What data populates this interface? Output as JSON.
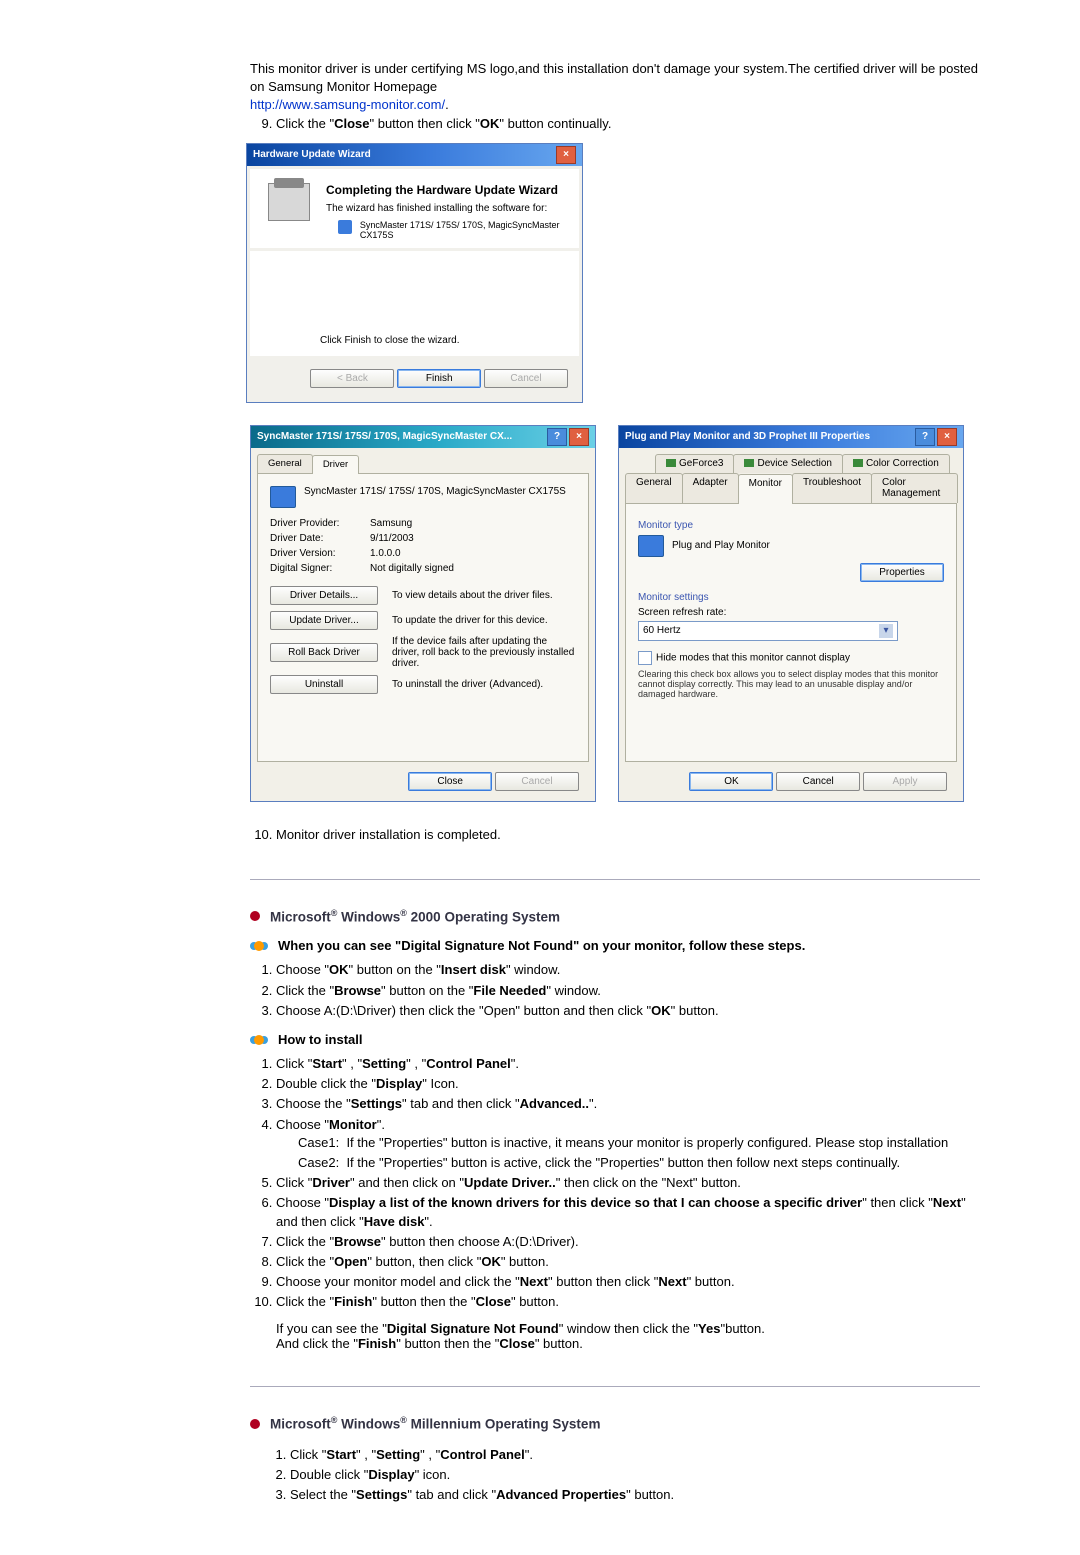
{
  "intro": {
    "line1": "This monitor driver is under certifying MS logo,and this installation don't damage your system.The certified driver will be posted on Samsung Monitor Homepage",
    "link": "http://www.samsung-monitor.com/",
    "period": ".",
    "step9_prefix": "Click the \"",
    "step9_close": "Close",
    "step9_mid": "\" button then click \"",
    "step9_ok": "OK",
    "step9_suffix": "\" button continually."
  },
  "wizard": {
    "title": "Hardware Update Wizard",
    "heading": "Completing the Hardware Update Wizard",
    "line": "The wizard has finished installing the software for:",
    "device": "SyncMaster 171S/ 175S/ 170S, MagicSyncMaster CX175S",
    "close_line": "Click Finish to close the wizard.",
    "btn_back": "< Back",
    "btn_finish": "Finish",
    "btn_cancel": "Cancel"
  },
  "driver_props": {
    "title": "SyncMaster 171S/ 175S/ 170S, MagicSyncMaster CX...",
    "tab_general": "General",
    "tab_driver": "Driver",
    "device": "SyncMaster 171S/ 175S/ 170S, MagicSyncMaster CX175S",
    "provider_k": "Driver Provider:",
    "provider_v": "Samsung",
    "date_k": "Driver Date:",
    "date_v": "9/11/2003",
    "version_k": "Driver Version:",
    "version_v": "1.0.0.0",
    "signer_k": "Digital Signer:",
    "signer_v": "Not digitally signed",
    "btn_details": "Driver Details...",
    "desc_details": "To view details about the driver files.",
    "btn_update": "Update Driver...",
    "desc_update": "To update the driver for this device.",
    "btn_rollback": "Roll Back Driver",
    "desc_rollback": "If the device fails after updating the driver, roll back to the previously installed driver.",
    "btn_uninstall": "Uninstall",
    "desc_uninstall": "To uninstall the driver (Advanced).",
    "btn_close": "Close",
    "btn_cancel": "Cancel"
  },
  "pnp_props": {
    "title": "Plug and Play Monitor and 3D Prophet III Properties",
    "tab_geforce": "GeForce3",
    "tab_devsel": "Device Selection",
    "tab_colorcorr": "Color Correction",
    "tab_general": "General",
    "tab_adapter": "Adapter",
    "tab_monitor": "Monitor",
    "tab_troubleshoot": "Troubleshoot",
    "tab_colormgmt": "Color Management",
    "group_monitor_type": "Monitor type",
    "monitor_name": "Plug and Play Monitor",
    "btn_props": "Properties",
    "group_monitor_settings": "Monitor settings",
    "refresh_label": "Screen refresh rate:",
    "refresh_value": "60 Hertz",
    "hide_modes": "Hide modes that this monitor cannot display",
    "note": "Clearing this check box allows you to select display modes that this monitor cannot display correctly. This may lead to an unusable display and/or damaged hardware.",
    "btn_ok": "OK",
    "btn_cancel": "Cancel",
    "btn_apply": "Apply"
  },
  "step10": "Monitor driver installation is completed.",
  "w2000": {
    "header_pre": "Microsoft",
    "header_mid": " Windows",
    "header_post": " 2000 Operating System",
    "sub1": "When you can see \"Digital Signature Not Found\" on your monitor, follow these steps.",
    "s1_a": "Choose \"",
    "s1_b": "OK",
    "s1_c": "\" button on the \"",
    "s1_d": "Insert disk",
    "s1_e": "\" window.",
    "s2_a": "Click the \"",
    "s2_b": "Browse",
    "s2_c": "\" button on the \"",
    "s2_d": "File Needed",
    "s2_e": "\" window.",
    "s3_a": "Choose A:(D:\\Driver) then click the \"Open\" button and then click \"",
    "s3_b": "OK",
    "s3_c": "\" button.",
    "sub2": "How to install",
    "h1_a": "Click \"",
    "h1_b": "Start",
    "h1_c": "\" , \"",
    "h1_d": "Setting",
    "h1_e": "\" , \"",
    "h1_f": "Control Panel",
    "h1_g": "\".",
    "h2_a": "Double click the \"",
    "h2_b": "Display",
    "h2_c": "\" Icon.",
    "h3_a": "Choose the \"",
    "h3_b": "Settings",
    "h3_c": "\" tab and then click \"",
    "h3_d": "Advanced..",
    "h3_e": "\".",
    "h4_a": "Choose \"",
    "h4_b": "Monitor",
    "h4_c": "\".",
    "case1_label": "Case1:",
    "case1_text": "If the \"Properties\" button is inactive, it means your monitor is properly configured. Please stop installation",
    "case2_label": "Case2:",
    "case2_text": "If the \"Properties\" button is active, click the \"Properties\" button then follow next steps continually.",
    "h5_a": "Click \"",
    "h5_b": "Driver",
    "h5_c": "\" and then click on \"",
    "h5_d": "Update Driver..",
    "h5_e": "\" then click on the \"Next\" button.",
    "h6_a": "Choose \"",
    "h6_b": "Display a list of the known drivers for this device so that I can choose a specific driver",
    "h6_c": "\" then click \"",
    "h6_d": "Next",
    "h6_e": "\" and then click \"",
    "h6_f": "Have disk",
    "h6_g": "\".",
    "h7_a": "Click the \"",
    "h7_b": "Browse",
    "h7_c": "\" button then choose A:(D:\\Driver).",
    "h8_a": "Click the \"",
    "h8_b": "Open",
    "h8_c": "\" button, then click \"",
    "h8_d": "OK",
    "h8_e": "\" button.",
    "h9_a": "Choose your monitor model and click the \"",
    "h9_b": "Next",
    "h9_c": "\" button then click \"",
    "h9_d": "Next",
    "h9_e": "\" button.",
    "h10_a": "Click the \"",
    "h10_b": "Finish",
    "h10_c": "\" button then the \"",
    "h10_d": "Close",
    "h10_e": "\" button.",
    "post1_a": "If you can see the \"",
    "post1_b": "Digital Signature Not Found",
    "post1_c": "\" window then click the \"",
    "post1_d": "Yes",
    "post1_e": "\"button.",
    "post2_a": "And click the \"",
    "post2_b": "Finish",
    "post2_c": "\" button then the \"",
    "post2_d": "Close",
    "post2_e": "\" button."
  },
  "wme": {
    "header_pre": "Microsoft",
    "header_mid": " Windows",
    "header_post": " Millennium Operating System",
    "m1_a": "Click \"",
    "m1_b": "Start",
    "m1_c": "\" , \"",
    "m1_d": "Setting",
    "m1_e": "\" , \"",
    "m1_f": "Control Panel",
    "m1_g": "\".",
    "m2_a": "Double click \"",
    "m2_b": "Display",
    "m2_c": "\" icon.",
    "m3_a": "Select the \"",
    "m3_b": "Settings",
    "m3_c": "\" tab and click \"",
    "m3_d": "Advanced Properties",
    "m3_e": "\" button."
  }
}
